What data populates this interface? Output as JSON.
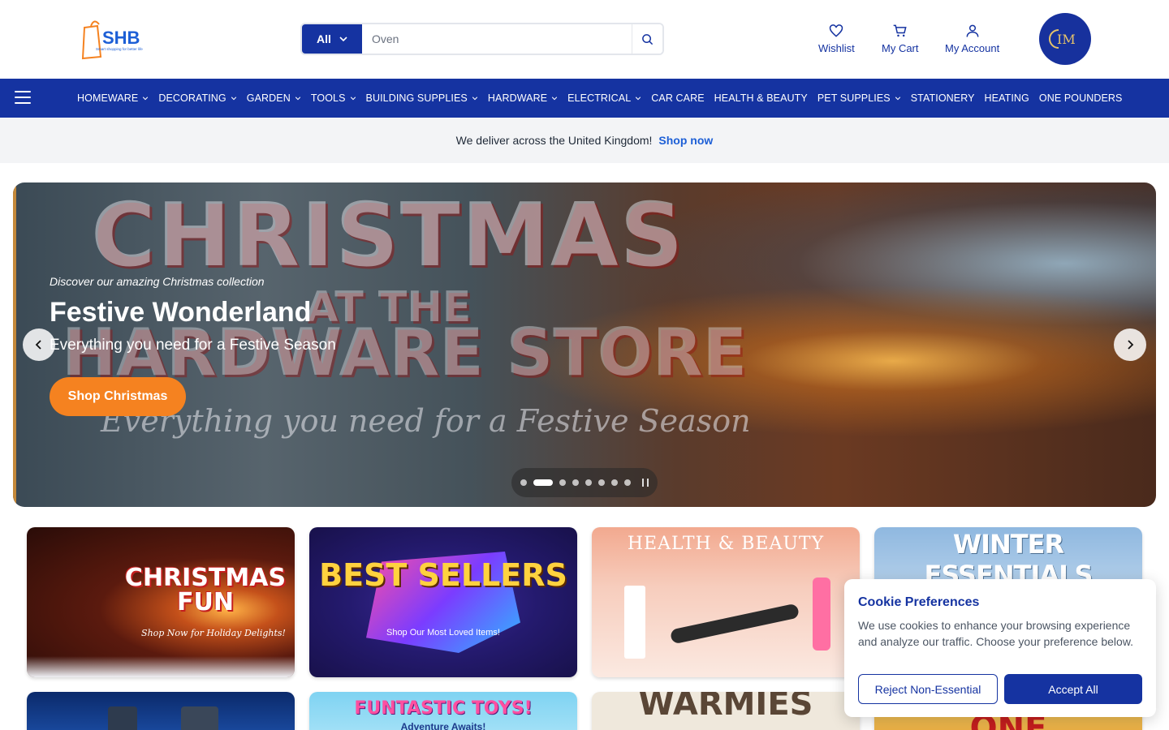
{
  "header": {
    "logo_text": "SHB",
    "logo_tagline": "Smart shopping for better life",
    "search": {
      "category": "All",
      "placeholder": "Oven"
    },
    "actions": [
      {
        "label": "Wishlist",
        "icon": "heart-icon"
      },
      {
        "label": "My Cart",
        "icon": "cart-icon"
      },
      {
        "label": "My Account",
        "icon": "user-icon"
      }
    ],
    "brand_badge": "IM"
  },
  "nav": {
    "items": [
      {
        "label": "HOMEWARE",
        "dropdown": true
      },
      {
        "label": "DECORATING",
        "dropdown": true
      },
      {
        "label": "GARDEN",
        "dropdown": true
      },
      {
        "label": "TOOLS",
        "dropdown": true
      },
      {
        "label": "BUILDING SUPPLIES",
        "dropdown": true
      },
      {
        "label": "HARDWARE",
        "dropdown": true
      },
      {
        "label": "ELECTRICAL",
        "dropdown": true
      },
      {
        "label": "CAR CARE",
        "dropdown": false
      },
      {
        "label": "HEALTH & BEAUTY",
        "dropdown": false
      },
      {
        "label": "PET SUPPLIES",
        "dropdown": true
      },
      {
        "label": "STATIONERY",
        "dropdown": false
      },
      {
        "label": "HEATING",
        "dropdown": false
      },
      {
        "label": "ONE POUNDERS",
        "dropdown": false
      }
    ]
  },
  "strip": {
    "text": "We deliver across the United Kingdom!",
    "link": "Shop now"
  },
  "hero": {
    "bg_line1": "CHRISTMAS",
    "bg_line2": "AT THE",
    "bg_line3": "HARDWARE STORE",
    "bg_script": "Everything you need for a Festive Season",
    "eyebrow": "Discover our amazing Christmas collection",
    "title": "Festive Wonderland",
    "subtitle": "Everything you need for a Festive Season",
    "cta": "Shop Christmas",
    "slides_total": 8,
    "active_slide": 2
  },
  "tiles": [
    {
      "title": "CHRISTMAS FUN",
      "subtitle": "Shop Now for Holiday Delights!"
    },
    {
      "title": "BEST SELLERS",
      "subtitle": "Shop Our Most Loved Items!"
    },
    {
      "title": "HEALTH & BEAUTY",
      "subtitle": ""
    },
    {
      "title": "WINTER ESSENTIALS",
      "subtitle": ""
    },
    {
      "title": "",
      "subtitle": ""
    },
    {
      "title": "FUNTASTIC TOYS!",
      "subtitle": "Adventure Awaits!"
    },
    {
      "title": "WARMIES",
      "subtitle": ""
    },
    {
      "title": "ONE",
      "subtitle": ""
    }
  ],
  "cookie": {
    "title": "Cookie Preferences",
    "text": "We use cookies to enhance your browsing experience and analyze our traffic. Choose your preference below.",
    "reject": "Reject Non-Essential",
    "accept": "Accept All"
  },
  "colors": {
    "brand_blue": "#1533a1",
    "accent_orange": "#f58220",
    "link_blue": "#1d5fd6"
  }
}
